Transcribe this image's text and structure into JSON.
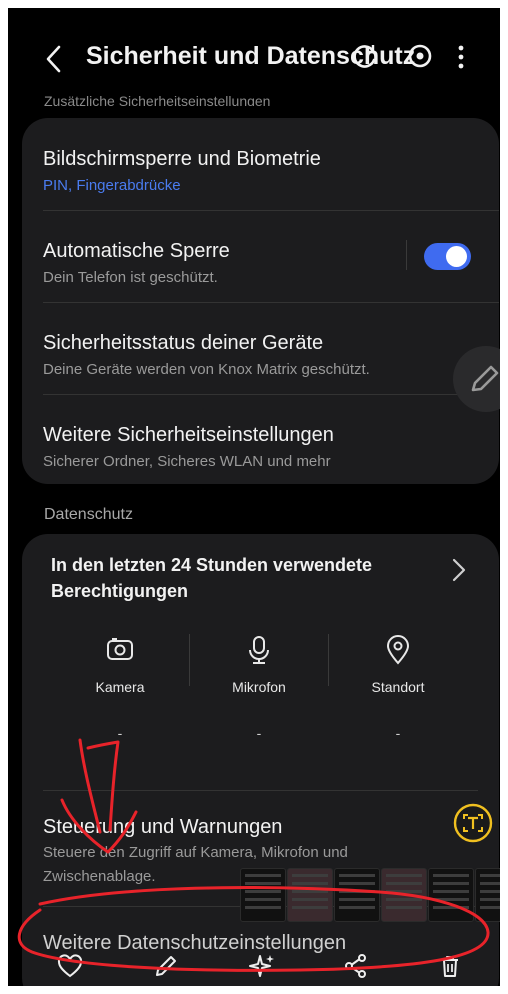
{
  "header": {
    "title": "Sicherheit und Datenschutz",
    "back_icon": "chevron-left-icon",
    "more_icon": "more-vertical-icon"
  },
  "faded_section_label": "Zusätzliche Sicherheitseinstellungen",
  "security": {
    "items": [
      {
        "title": "Bildschirmsperre und Biometrie",
        "subtitle": "PIN, Fingerabdrücke"
      },
      {
        "title": "Automatische Sperre",
        "subtitle": "Dein Telefon ist geschützt.",
        "toggle_on": true
      },
      {
        "title": "Sicherheitsstatus deiner Geräte",
        "subtitle": "Deine Geräte werden von Knox Matrix geschützt."
      },
      {
        "title": "Weitere Sicherheitseinstellungen",
        "subtitle": "Sicherer Ordner, Sicheres WLAN und mehr"
      }
    ]
  },
  "privacy": {
    "section_label": "Datenschutz",
    "permissions_title": "In den letzten 24 Stunden verwendete Berechtigungen",
    "permissions": [
      {
        "label": "Kamera",
        "value": "-",
        "icon": "camera-icon"
      },
      {
        "label": "Mikrofon",
        "value": "-",
        "icon": "microphone-icon"
      },
      {
        "label": "Standort",
        "value": "-",
        "icon": "location-pin-icon"
      }
    ],
    "items": [
      {
        "title": "Steuerung und Warnungen",
        "subtitle": "Steuere den Zugriff auf Kamera, Mikrofon und Zwischenablage."
      },
      {
        "title": "Weitere Datenschutzeinstellungen"
      }
    ]
  },
  "bottom_bar": [
    "heart-icon",
    "pencil-icon",
    "sparkle-icon",
    "share-icon",
    "trash-icon"
  ],
  "colors": {
    "accent": "#3f6bf0",
    "link": "#4a7cf0",
    "annotation": "#e8232a",
    "ocr_button": "#f0c020"
  }
}
